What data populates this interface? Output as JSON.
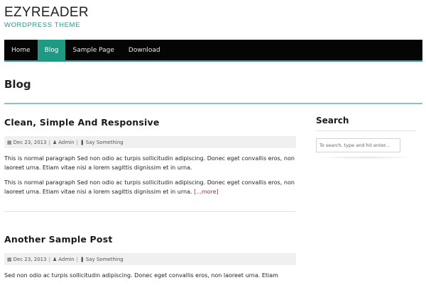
{
  "header": {
    "site_title": "EZYREADER",
    "tagline": "WORDPRESS THEME"
  },
  "nav": {
    "items": [
      {
        "label": "Home",
        "active": false
      },
      {
        "label": "Blog",
        "active": true
      },
      {
        "label": "Sample Page",
        "active": false
      },
      {
        "label": "Download",
        "active": false
      }
    ]
  },
  "page": {
    "title": "Blog"
  },
  "posts": [
    {
      "title": "Clean, Simple And Responsive",
      "date": "Dec 23, 2013",
      "author": "Admin",
      "comments": "Say Something",
      "paragraphs": [
        "This is normal paragraph Sed non odio ac turpis sollicitudin adipiscing. Donec eget convallis eros, non laoreet urna. Etiam vitae nisi a lorem sagittis dignissim et in urna.",
        "This is normal paragraph Sed non odio ac turpis sollicitudin adipiscing. Donec eget convallis eros, non laoreet urna. Etiam vitae nisi a lorem sagittis dignissim et in urna."
      ],
      "more_label": "[...more]"
    },
    {
      "title": "Another Sample Post",
      "date": "Dec 23, 2013",
      "author": "Admin",
      "comments": "Say Something",
      "paragraphs": [
        "Sed non odio ac turpis sollicitudin adipiscing. Donec eget convallis eros, non laoreet urna. Etiam"
      ]
    }
  ],
  "sidebar": {
    "search_title": "Search",
    "search_placeholder": "To search, type and hit enter..."
  },
  "colors": {
    "accent": "#1e9983",
    "nav_background": "#050505",
    "more_link": "#9b3030"
  },
  "icons": {
    "date": "calendar-icon",
    "author": "user-icon",
    "comments": "comment-icon"
  }
}
